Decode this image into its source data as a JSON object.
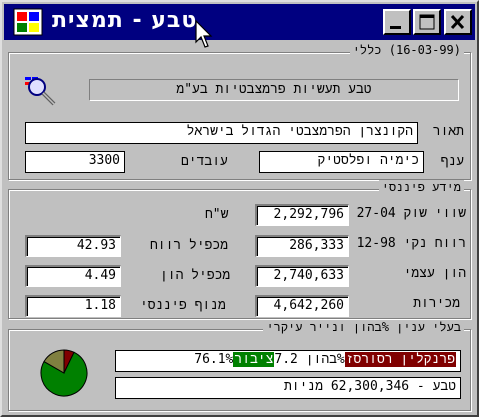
{
  "window": {
    "title": "טבע - תמצית"
  },
  "general": {
    "legend": "(16-03-99) כללי",
    "company_full_name": "טבע תעשיות פרמצבטיות בע\"מ",
    "description_label": "תאור",
    "description": "הקונצרן הפרמצבטי הגדול בישראל",
    "branch_label": "ענף",
    "branch": "כימיה ופלסטיק",
    "employees_label": "עובדים",
    "employees": "3300"
  },
  "financial": {
    "legend": "מידע פיננסי",
    "market_value_label": "שווי שוק 27-04",
    "market_value": "2,292,796",
    "currency_label": "ש\"ח",
    "net_profit_label": "רווח נקי 12-98",
    "net_profit": "286,333",
    "pe_label": "מכפיל רווח",
    "pe": "42.93",
    "equity_label": "הון עצמי",
    "equity": "2,740,633",
    "pb_label": "מכפיל הון",
    "pb": "4.49",
    "sales_label": "מכירות",
    "sales": "4,642,260",
    "leverage_label": "מנוף פיננסי",
    "leverage": "1.18"
  },
  "holders": {
    "legend": "בעלי ענין %בהון ונייר עיקרי",
    "holder_name": "פרנקלין רסורסז",
    "holder_pct_text": "%בהון 7.2",
    "public_label": "ציבור",
    "public_pct": "76.1%",
    "shares_text": "טבע - 62,300,346 מניות",
    "pie": [
      {
        "name": "פרנקלין רסורסז",
        "value": 7.2,
        "color": "#800000"
      },
      {
        "name": "ציבור",
        "value": 76.1,
        "color": "#008000"
      },
      {
        "name": "",
        "value": 16.7,
        "color": "#808040"
      }
    ]
  }
}
